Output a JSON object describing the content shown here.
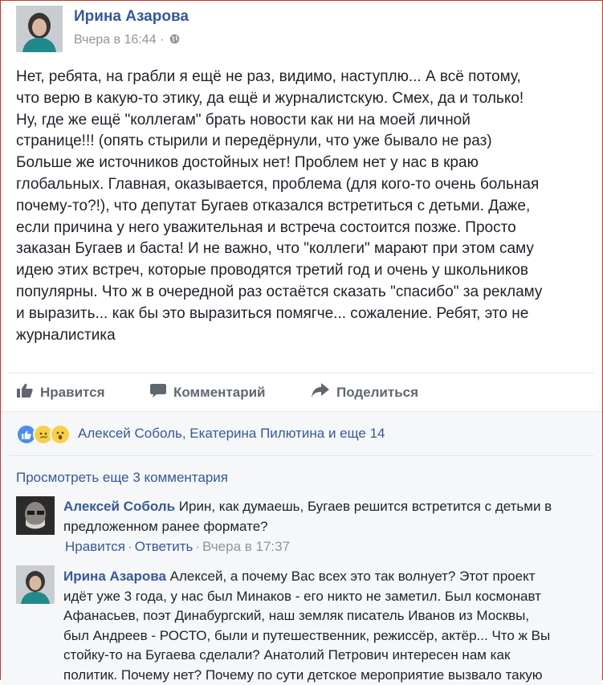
{
  "post": {
    "author": "Ирина Азарова",
    "time": "Вчера в 16:44",
    "privacy_icon": "globe-icon",
    "text_lines": [
      "Нет, ребята, на грабли я ещё не раз, видимо, наступлю... А всё потому,",
      "что верю в какую-то этику, да ещё и журналистскую. Смех, да и только!",
      "Ну, где же ещё \"коллегам\" брать новости как ни на моей личной",
      "странице!!! (опять стырили и передёрнули, что уже бывало не раз)",
      "Больше же источников достойных нет! Проблем нет у нас в краю",
      "глобальных. Главная, оказывается, проблема (для кого-то очень больная",
      "почему-то?!), что депутат Бугаев отказался встретиться с детьми. Даже,",
      "если причина у него уважительная и встреча состоится позже. Просто",
      "заказан Бугаев и баста! И не важно, что \"коллеги\" марают при этом саму",
      "идею этих встреч, которые проводятся третий год и очень у школьников",
      "популярны. Что ж в очередной раз остаётся сказать \"спасибо\" за рекламу",
      "и выразить... как бы это выразиться помягче... сожаление. Ребят, это не",
      "журналистика"
    ]
  },
  "actions": {
    "like": "Нравится",
    "comment": "Комментарий",
    "share": "Поделиться"
  },
  "reactions": {
    "icons": [
      "like-reaction-icon",
      "sad-reaction-icon",
      "wow-reaction-icon"
    ],
    "text": "Алексей Соболь, Екатерина Пилютина и еще 14"
  },
  "view_more": "Просмотреть еще 3 комментария",
  "comments": [
    {
      "author": "Алексей Соболь",
      "lines": [
        "Ирин, как думаешь, Бугаев решится встретится с детьми в",
        "предложенном ранее формате?"
      ],
      "like": "Нравится",
      "reply": "Ответить",
      "time": "Вчера в 17:37"
    },
    {
      "author": "Ирина Азарова",
      "lines": [
        "Алексей, а почему Вас всех это так волнует? Этот проект",
        "идёт уже 3 года, у нас был Минаков - его никто не заметил. Был космонавт",
        "Афанасьев, поэт Динабургский, наш земляк писатель Иванов из Москвы,",
        "был Андреев - РОСТО, были и путешественник, режиссёр, актёр... Что ж Вы",
        "стойку-то на Бугаева сделали? Анатолий Петрович интересен нам как",
        "политик. Почему нет? Почему по сути детское мероприятие вызвало такую"
      ]
    }
  ],
  "colors": {
    "link": "#365899",
    "muted": "#90949c",
    "text": "#1d2129",
    "comment_bg": "#f6f7f9"
  }
}
